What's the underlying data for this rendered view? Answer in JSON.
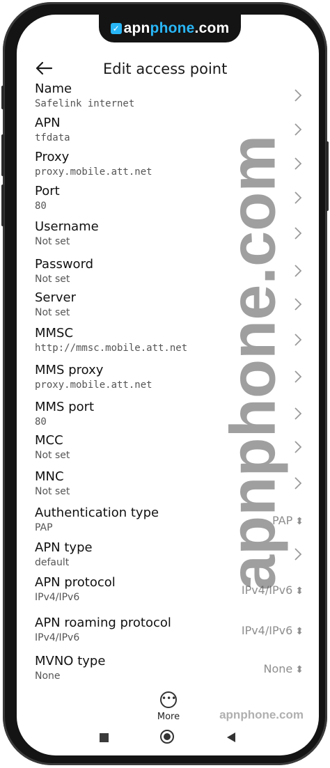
{
  "brand": {
    "prefix": "apn",
    "highlight": "phone",
    "suffix": ".com"
  },
  "header": {
    "title": "Edit access point"
  },
  "fields": [
    {
      "label": "Name",
      "value": "Safelink internet",
      "control": "chevron"
    },
    {
      "label": "APN",
      "value": "tfdata",
      "control": "chevron"
    },
    {
      "label": "Proxy",
      "value": "proxy.mobile.att.net",
      "control": "chevron"
    },
    {
      "label": "Port",
      "value": "80",
      "control": "chevron"
    },
    {
      "label": "Username",
      "value": "Not set",
      "control": "chevron"
    },
    {
      "label": "Password",
      "value": "Not set",
      "control": "chevron"
    },
    {
      "label": "Server",
      "value": "Not set",
      "control": "chevron"
    },
    {
      "label": "MMSC",
      "value": "http://mmsc.mobile.att.net",
      "control": "chevron"
    },
    {
      "label": "MMS proxy",
      "value": "proxy.mobile.att.net",
      "control": "chevron"
    },
    {
      "label": "MMS port",
      "value": "80",
      "control": "chevron"
    },
    {
      "label": "MCC",
      "value": "Not set",
      "control": "chevron"
    },
    {
      "label": "MNC",
      "value": "Not set",
      "control": "chevron"
    },
    {
      "label": "Authentication type",
      "value": "PAP",
      "control": "select",
      "selected": "PAP"
    },
    {
      "label": "APN type",
      "value": "default",
      "control": "chevron"
    },
    {
      "label": "APN protocol",
      "value": "IPv4/IPv6",
      "control": "select",
      "selected": "IPv4/IPv6"
    },
    {
      "label": "APN roaming protocol",
      "value": "IPv4/IPv6",
      "control": "select",
      "selected": "IPv4/IPv6"
    },
    {
      "label": "MVNO type",
      "value": "None",
      "control": "select",
      "selected": "None"
    }
  ],
  "more": {
    "label": "More"
  },
  "watermark": {
    "vertical": "apnphone.com",
    "footer": "apnphone.com"
  },
  "colors": {
    "accent": "#29b6f6",
    "frame": "#141414"
  }
}
